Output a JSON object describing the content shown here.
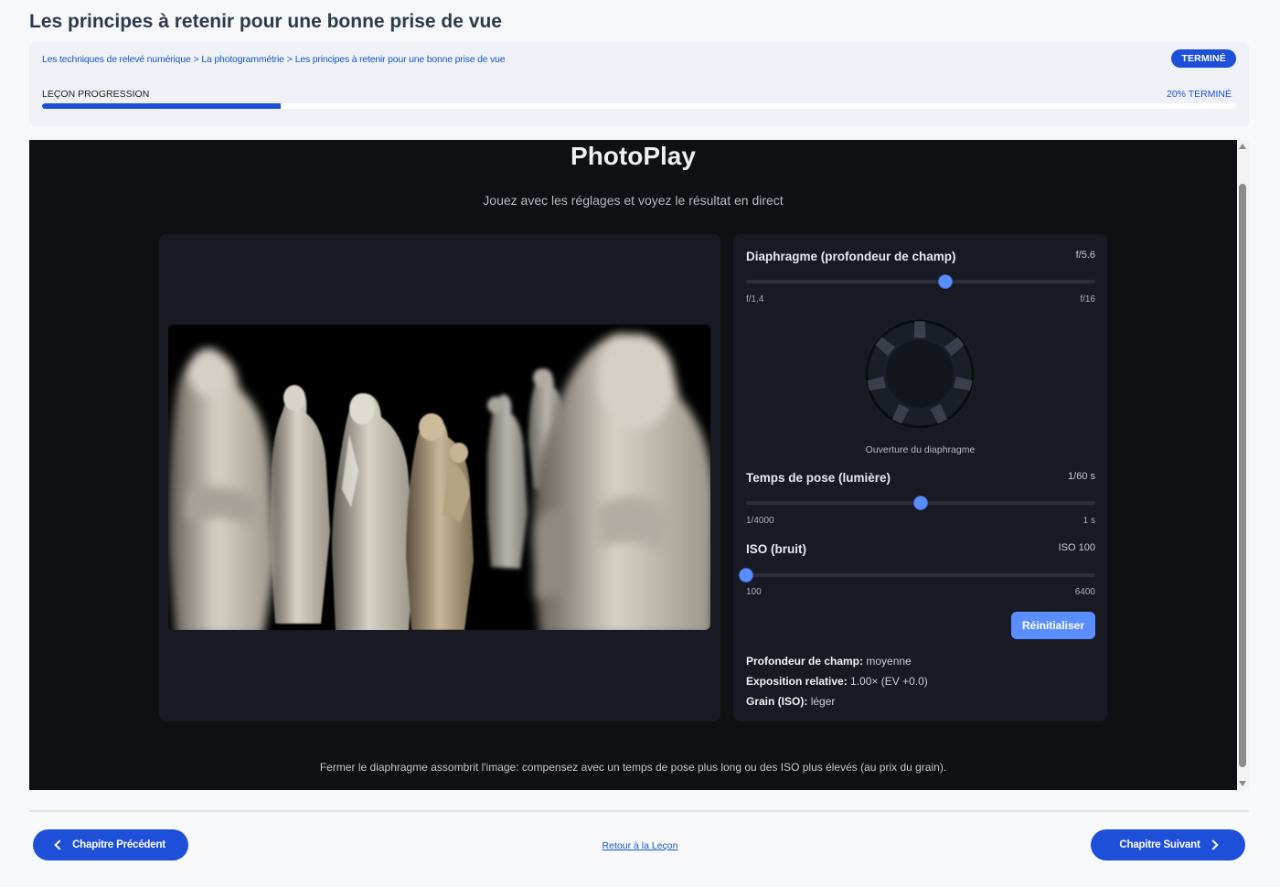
{
  "page": {
    "title": "Les principes à retenir pour une bonne prise de vue"
  },
  "breadcrumb": {
    "items": [
      "Les techniques de relevé numérique",
      "La photogrammétrie",
      "Les principes à retenir pour une bonne prise de vue"
    ],
    "separator": ">"
  },
  "progress": {
    "badge": "TERMINÉ",
    "label": "LEÇON PROGRESSION",
    "percent_text": "20% TERMINÉ",
    "fraction": 0.2
  },
  "app": {
    "title": "PhotoPlay",
    "subtitle": "Jouez avec les réglages et voyez le résultat en direct",
    "controls": {
      "aperture": {
        "label": "Diaphragme (profondeur de champ)",
        "value": "f/5.6",
        "min": "f/1.4",
        "max": "f/16",
        "position": 0.57
      },
      "aperture_caption": "Ouverture du diaphragme",
      "shutter": {
        "label": "Temps de pose (lumière)",
        "value": "1/60 s",
        "min": "1/4000",
        "max": "1 s",
        "position": 0.5
      },
      "iso": {
        "label": "ISO (bruit)",
        "value": "ISO 100",
        "min": "100",
        "max": "6400",
        "position": 0.0
      },
      "reset_label": "Réinitialiser"
    },
    "stats": {
      "depth_label": "Profondeur de champ:",
      "depth_value": "moyenne",
      "exposure_label": "Exposition relative:",
      "exposure_value": "1.00× (EV +0.0)",
      "grain_label": "Grain (ISO):",
      "grain_value": "léger"
    },
    "footnote": "Fermer le diaphragme assombrit l'image: compensez avec un temps de pose plus long ou des ISO plus élevés (au prix du grain)."
  },
  "footer": {
    "prev_label": "Chapitre Précédent",
    "next_label": "Chapitre Suivant",
    "back_label": "Retour à la Leçon"
  },
  "colors": {
    "accent": "#1d4fd8",
    "slider": "#5a8dff",
    "app_bg": "#0e1014",
    "panel_bg": "#171a22"
  }
}
